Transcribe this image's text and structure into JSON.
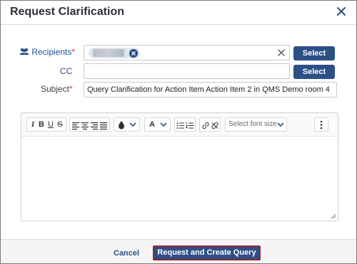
{
  "dialog": {
    "title": "Request Clarification"
  },
  "form": {
    "recipients_label": "Recipients",
    "cc_label": "CC",
    "subject_label": "Subject",
    "required_marker": "*",
    "select_label": "Select",
    "subject_value": "Query Clarification for Action Item Action Item 2 in QMS Demo room 4"
  },
  "editor": {
    "font_size_placeholder": "Select font size",
    "toolbar_icons": [
      "italic-icon",
      "bold-icon",
      "underline-icon",
      "strikethrough-icon",
      "align-left-icon",
      "align-center-icon",
      "align-right-icon",
      "align-justify-icon",
      "text-color-icon",
      "font-icon",
      "bullet-list-icon",
      "numbered-list-icon",
      "link-icon",
      "unlink-icon",
      "more-icon"
    ]
  },
  "footer": {
    "cancel_label": "Cancel",
    "primary_label": "Request and Create Query"
  },
  "colors": {
    "primary": "#2c4f86",
    "required": "#d63333",
    "focus_border": "#a31f2c"
  }
}
